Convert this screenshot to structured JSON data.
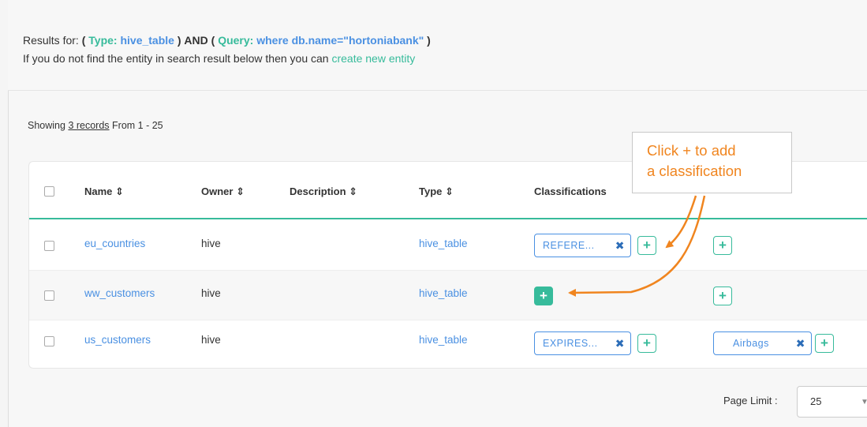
{
  "results": {
    "prefix": "Results for:",
    "open1": "(",
    "type_key": "Type:",
    "type_val": "hive_table",
    "close1": ")",
    "and": "AND",
    "open2": "(",
    "query_key": "Query:",
    "query_val": "where db.name=\"hortoniabank\"",
    "close2": ")",
    "hint": "If you do not find the entity in search result below then you can",
    "create_link": "create new entity"
  },
  "showing": {
    "prefix": "Showing",
    "count": "3 records",
    "range": "From 1 - 25"
  },
  "table": {
    "headers": {
      "name": "Name ⇕",
      "owner": "Owner ⇕",
      "description": "Description ⇕",
      "type": "Type ⇕",
      "classifications": "Classifications"
    },
    "rows": [
      {
        "name": "eu_countries",
        "owner": "hive",
        "type": "hive_table",
        "classification": "REFERE...",
        "term": ""
      },
      {
        "name": "ww_customers",
        "owner": "hive",
        "type": "hive_table",
        "classification": "",
        "term": ""
      },
      {
        "name": "us_customers",
        "owner": "hive",
        "type": "hive_table",
        "classification": "EXPIRES...",
        "term": "Airbags"
      }
    ]
  },
  "icons": {
    "plus": "+",
    "remove": "✖",
    "caret": "▼"
  },
  "callout": {
    "line1": "Click + to add",
    "line2": "a classification"
  },
  "pagination": {
    "page_limit_label": "Page Limit :",
    "page_limit_value": "25"
  },
  "colors": {
    "accent_green": "#37bb9b",
    "link_blue": "#4a90e2",
    "callout_orange": "#f0851f"
  }
}
